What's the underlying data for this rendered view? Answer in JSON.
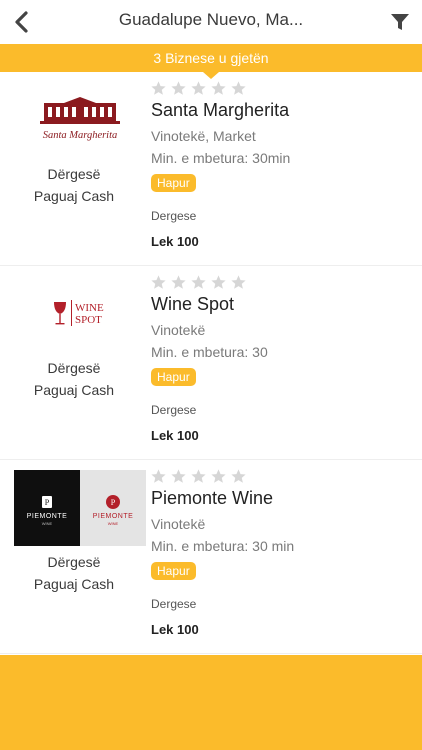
{
  "header": {
    "title": "Guadalupe Nuevo, Ma...",
    "back_icon": "chevron-left-icon",
    "filter_icon": "filter-funnel-icon"
  },
  "result_count": "3 Biznese u gjetën",
  "colors": {
    "accent": "#fbbb2b",
    "star_empty": "#d6d6d6",
    "brand_red": "#8b1a1f"
  },
  "businesses": [
    {
      "logo_text": "Santa Margherita",
      "name": "Santa Margherita",
      "category": "Vinotekë, Market",
      "min_order": "Min. e mbetura: 30min",
      "status": "Hapur",
      "delivery_type": "Dergese",
      "price": "Lek 100",
      "delivery_label": "Dërgesë",
      "payment_label": "Paguaj Cash",
      "rating": 0
    },
    {
      "logo_text_top": "WINE",
      "logo_text_bottom": "SPOT",
      "name": "Wine Spot",
      "category": "Vinotekë",
      "min_order": "Min. e mbetura: 30",
      "status": "Hapur",
      "delivery_type": "Dergese",
      "price": "Lek 100",
      "delivery_label": "Dërgesë",
      "payment_label": "Paguaj Cash",
      "rating": 0
    },
    {
      "logo_text": "PIEMONTE",
      "logo_sub": "WINE",
      "name": "Piemonte Wine",
      "category": "Vinotekë",
      "min_order": "Min. e mbetura: 30 min",
      "status": "Hapur",
      "delivery_type": "Dergese",
      "price": "Lek 100",
      "delivery_label": "Dërgesë",
      "payment_label": "Paguaj Cash",
      "rating": 0
    }
  ]
}
